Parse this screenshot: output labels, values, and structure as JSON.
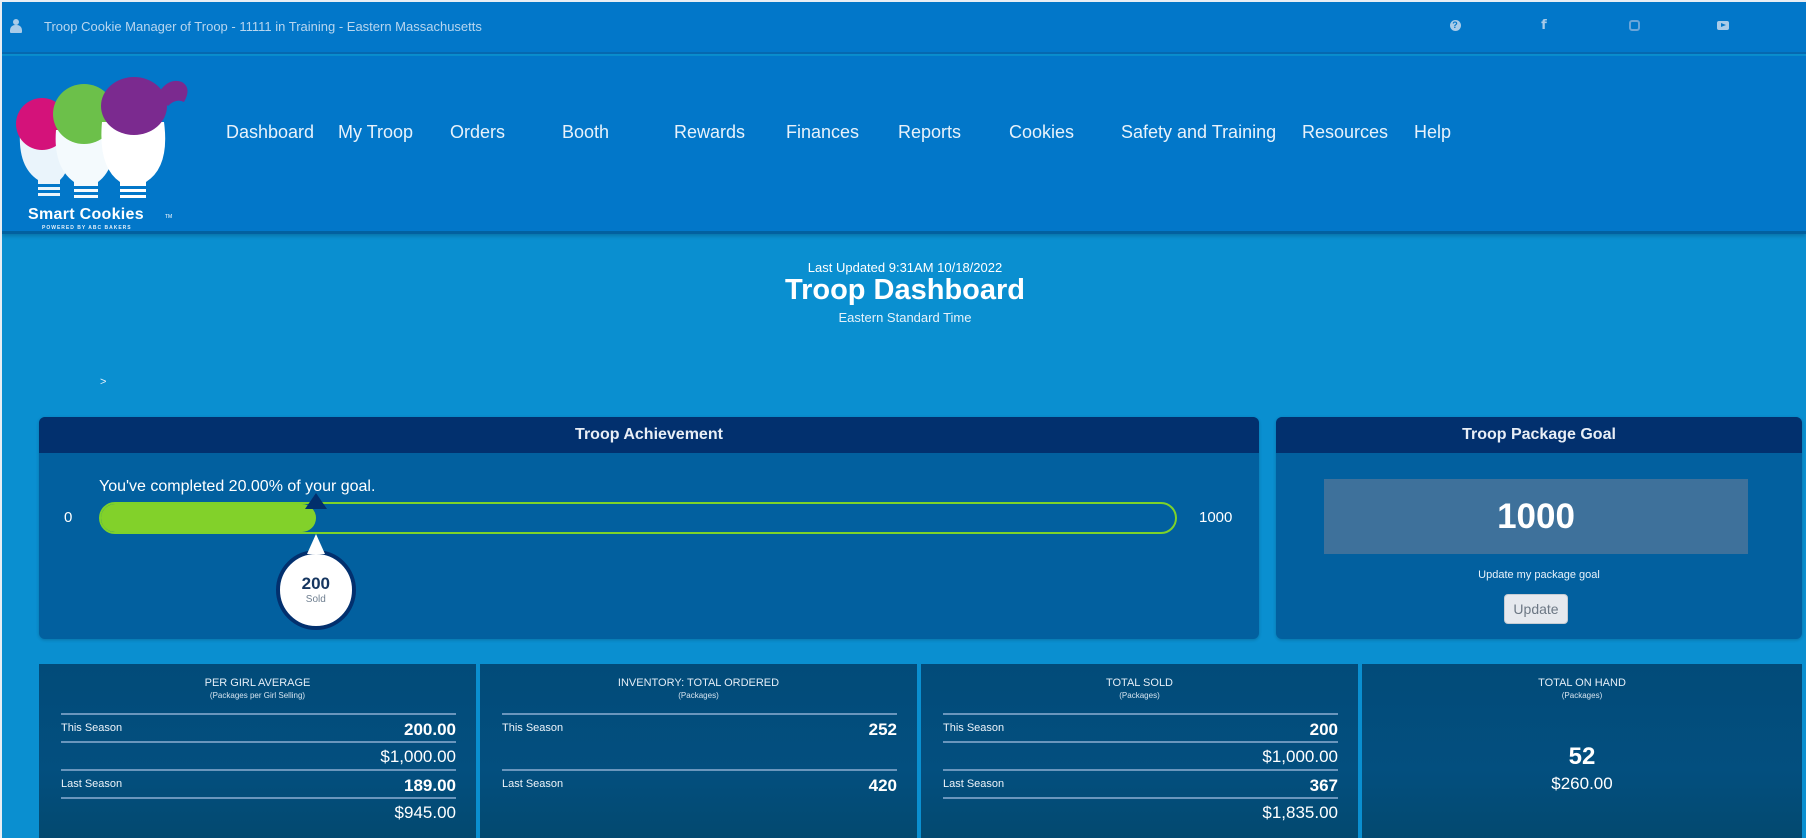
{
  "topbar": {
    "user_icon": "user-icon",
    "title": "Troop Cookie Manager of Troop - 11111 in Training - Eastern Massachusetts",
    "social_icons": [
      "help-icon",
      "facebook-icon",
      "instagram-icon",
      "youtube-icon"
    ],
    "facebook_glyph": "f",
    "help_glyph": "?"
  },
  "logo": {
    "name": "Smart Cookies",
    "tm": "TM",
    "tagline": "POWERED BY ABC BAKERS",
    "colors": {
      "pink": "#d4127a",
      "green": "#6cc04a",
      "purple": "#7b2a8f"
    }
  },
  "nav": {
    "items": [
      {
        "label": "Dashboard"
      },
      {
        "label": "My Troop"
      },
      {
        "label": "Orders"
      },
      {
        "label": "Booth"
      },
      {
        "label": "Rewards"
      },
      {
        "label": "Finances"
      },
      {
        "label": "Reports"
      },
      {
        "label": "Cookies"
      },
      {
        "label": "Safety and Training"
      },
      {
        "label": "Resources"
      },
      {
        "label": "Help"
      }
    ]
  },
  "header": {
    "last_updated": "Last Updated 9:31AM 10/18/2022",
    "title": "Troop Dashboard",
    "timezone": "Eastern Standard Time",
    "breadcrumb_arrow": ">"
  },
  "achievement": {
    "title": "Troop Achievement",
    "completed_text": "You've completed 20.00% of your goal.",
    "min": "0",
    "max": "1000",
    "progress_fraction": 0.2,
    "sold_value": "200",
    "sold_label": "Sold",
    "colors": {
      "fill": "#82d12a",
      "header": "#02306e"
    }
  },
  "goal": {
    "title": "Troop Package Goal",
    "value": "1000",
    "hint": "Update my package goal",
    "button_label": "Update"
  },
  "stats": [
    {
      "title": "PER GIRL AVERAGE",
      "subtitle": "(Packages per Girl Selling)",
      "this_season_label": "This Season",
      "this_season_value": "200.00",
      "this_season_amount": "$1,000.00",
      "last_season_label": "Last Season",
      "last_season_value": "189.00",
      "last_season_amount": "$945.00"
    },
    {
      "title": "INVENTORY: TOTAL ORDERED",
      "subtitle": "(Packages)",
      "this_season_label": "This Season",
      "this_season_value": "252",
      "last_season_label": "Last Season",
      "last_season_value": "420"
    },
    {
      "title": "TOTAL SOLD",
      "subtitle": "(Packages)",
      "this_season_label": "This Season",
      "this_season_value": "200",
      "this_season_amount": "$1,000.00",
      "last_season_label": "Last Season",
      "last_season_value": "367",
      "last_season_amount": "$1,835.00"
    },
    {
      "title": "TOTAL ON HAND",
      "subtitle": "(Packages)",
      "quantity": "52",
      "amount": "$260.00"
    }
  ]
}
